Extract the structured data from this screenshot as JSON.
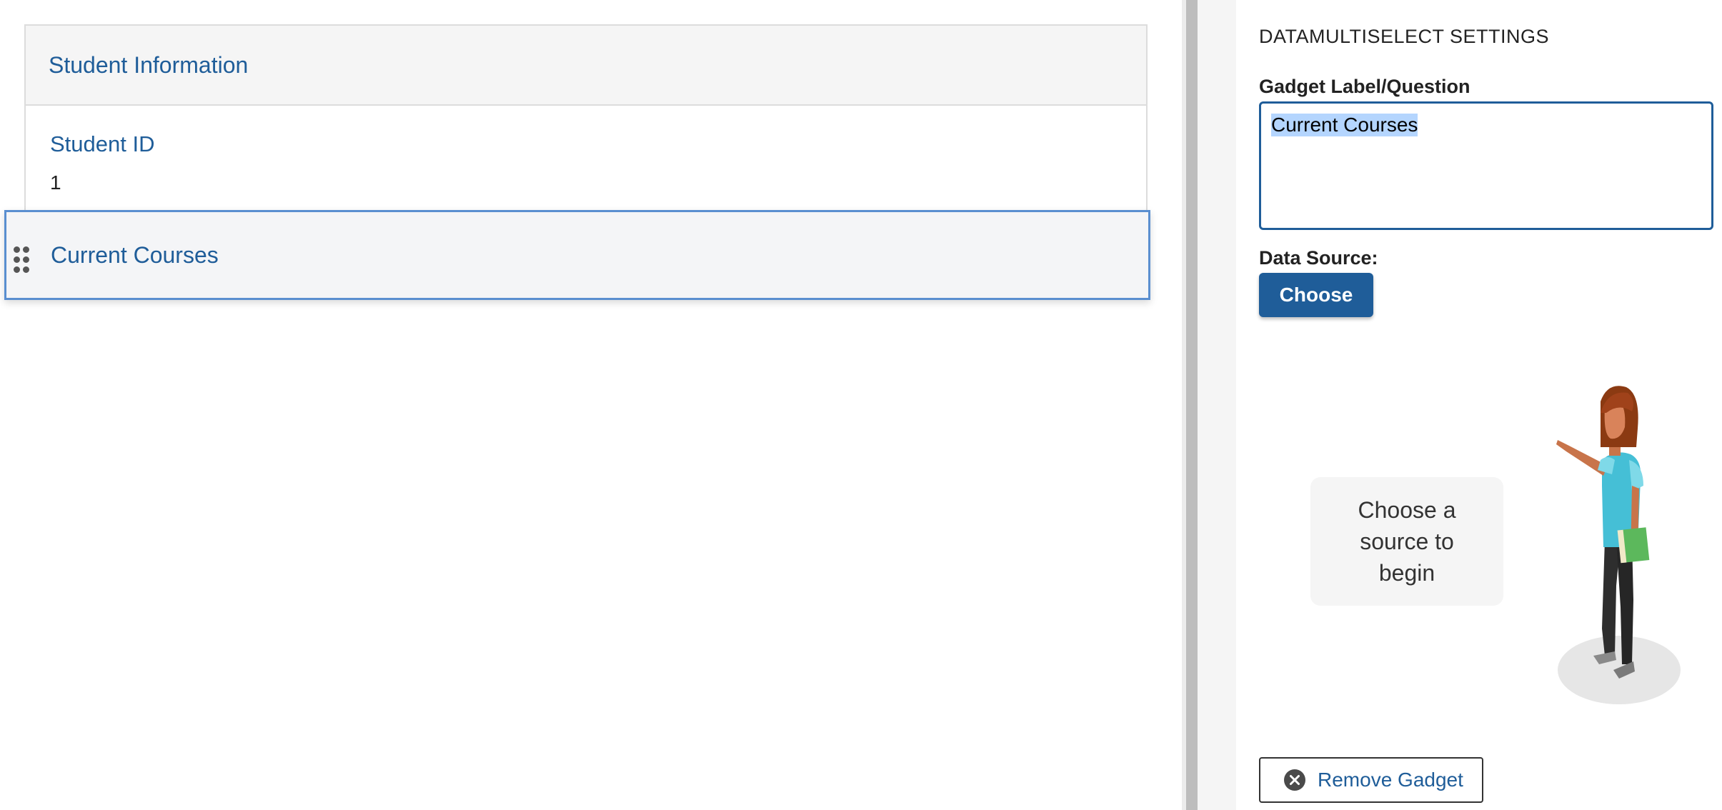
{
  "form": {
    "section_header": "Student Information",
    "fields": [
      {
        "label": "Student ID",
        "value": "1"
      }
    ],
    "dragging_gadget": {
      "label": "Current Courses"
    }
  },
  "settings": {
    "title": "DATAMULTISELECT SETTINGS",
    "gadget_label_caption": "Gadget Label/Question",
    "gadget_label_value": "Current Courses",
    "data_source_caption": "Data Source:",
    "choose_label": "Choose",
    "hint_text": "Choose a source to begin",
    "remove_label": "Remove Gadget"
  },
  "icons": {
    "drag_handle": "drag-handle-icon",
    "remove": "close-circle-icon",
    "illustration": "pointing-woman-illustration"
  },
  "colors": {
    "accent": "#1f5d99",
    "drag_border": "#5a8fd0",
    "selection": "#b4d5fe"
  }
}
